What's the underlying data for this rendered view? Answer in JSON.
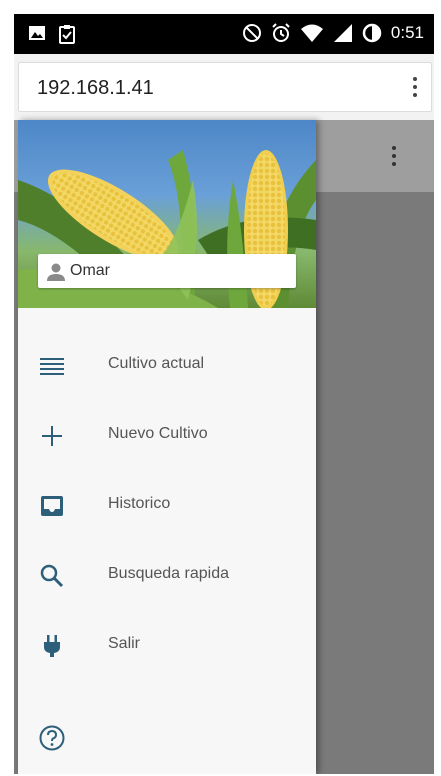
{
  "status_bar": {
    "time": "0:51",
    "left_icons": [
      "image-icon",
      "clipboard-check-icon"
    ],
    "right_icons": [
      "do-not-disturb-icon",
      "alarm-icon",
      "wifi-icon",
      "signal-icon",
      "battery-icon"
    ]
  },
  "browser": {
    "url": "192.168.1.41"
  },
  "drawer": {
    "user_name": "Omar",
    "items": [
      {
        "label": "Cultivo actual",
        "icon": "list-icon"
      },
      {
        "label": "Nuevo Cultivo",
        "icon": "plus-icon"
      },
      {
        "label": "Historico",
        "icon": "inbox-icon"
      },
      {
        "label": "Busqueda rapida",
        "icon": "search-icon"
      },
      {
        "label": "Salir",
        "icon": "plug-icon"
      }
    ],
    "help_icon": "help-icon"
  },
  "colors": {
    "accent_icon": "#2e5f7a",
    "drawer_bg": "#f7f7f7",
    "scrim": "#7a7a7a"
  }
}
